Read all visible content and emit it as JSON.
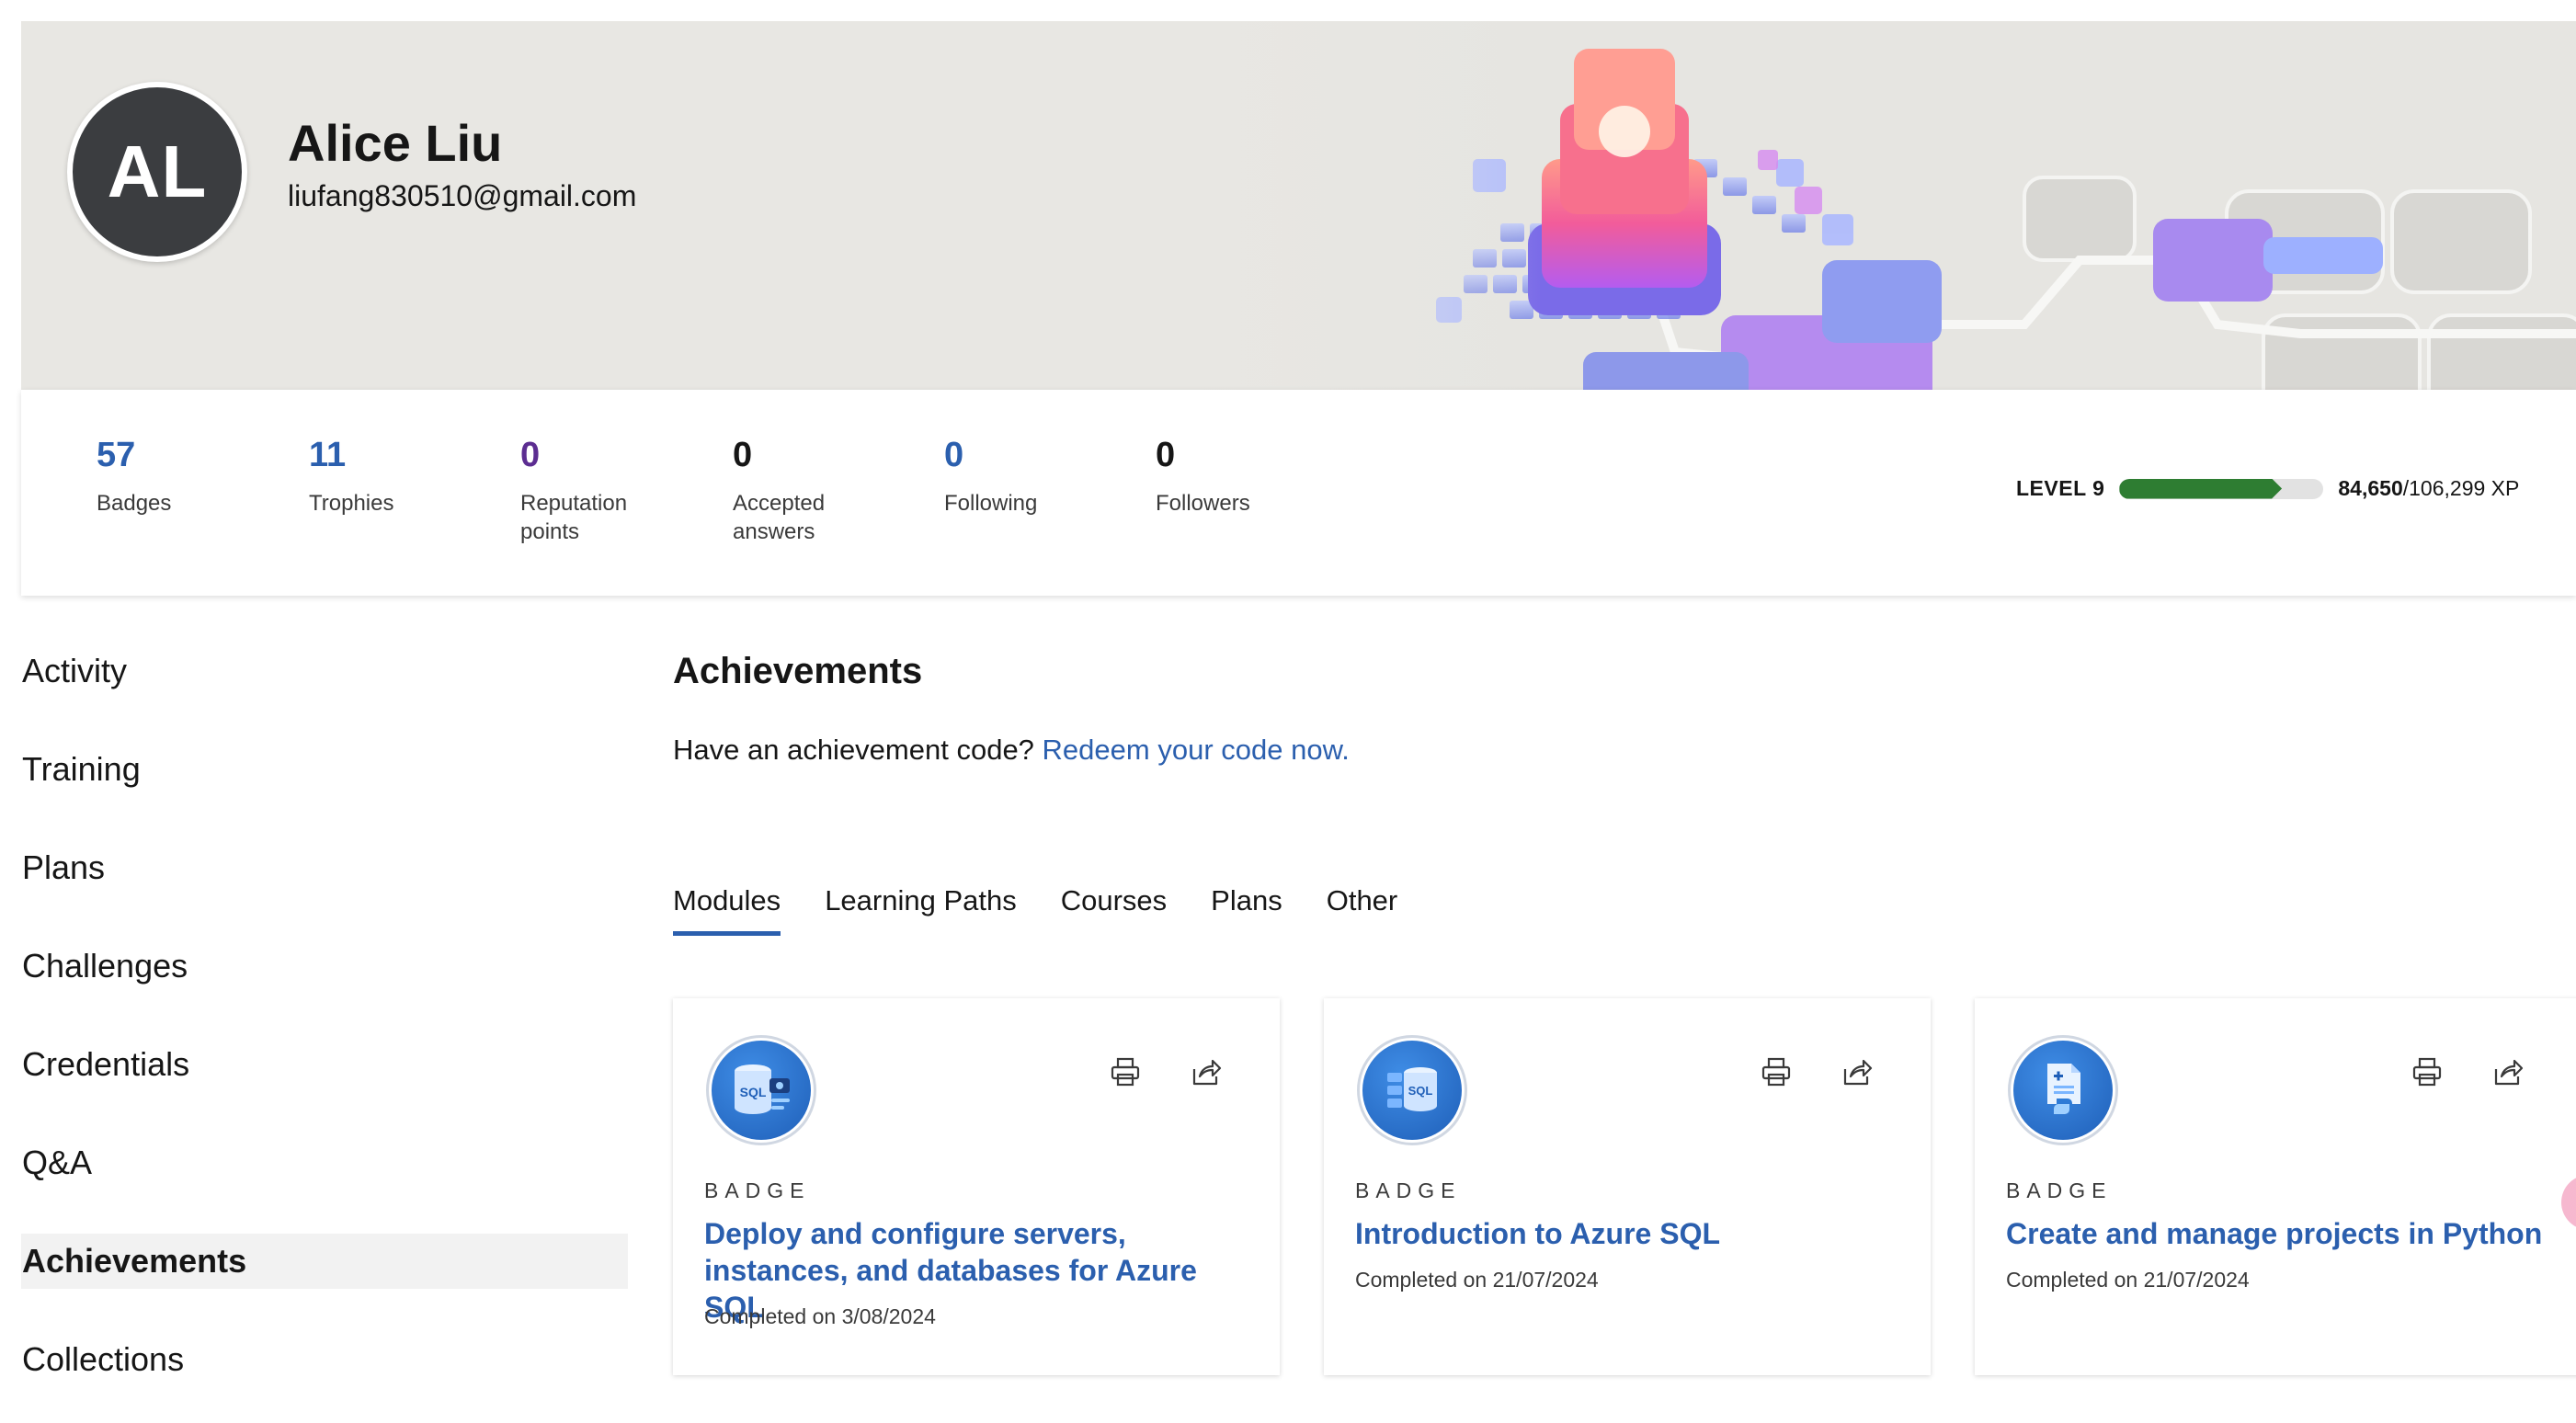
{
  "profile": {
    "initials": "AL",
    "name": "Alice Liu",
    "email": "liufang830510@gmail.com"
  },
  "stats": [
    {
      "value": "57",
      "label_line1": "Badges",
      "label_line2": "",
      "color": "#2b5fae"
    },
    {
      "value": "11",
      "label_line1": "Trophies",
      "label_line2": "",
      "color": "#2b5fae"
    },
    {
      "value": "0",
      "label_line1": "Reputation",
      "label_line2": "points",
      "color": "#5c2d91"
    },
    {
      "value": "0",
      "label_line1": "Accepted",
      "label_line2": "answers",
      "color": "#161616"
    },
    {
      "value": "0",
      "label_line1": "Following",
      "label_line2": "",
      "color": "#2b5fae"
    },
    {
      "value": "0",
      "label_line1": "Followers",
      "label_line2": "",
      "color": "#161616"
    }
  ],
  "level": {
    "label": "LEVEL 9",
    "xp_current": "84,650",
    "xp_total": "/106,299 XP",
    "progress_fraction": 0.796,
    "bar_color": "#2e7d32"
  },
  "sidebar": {
    "items": [
      {
        "label": "Activity",
        "active": false
      },
      {
        "label": "Training",
        "active": false
      },
      {
        "label": "Plans",
        "active": false
      },
      {
        "label": "Challenges",
        "active": false
      },
      {
        "label": "Credentials",
        "active": false
      },
      {
        "label": "Q&A",
        "active": false
      },
      {
        "label": "Achievements",
        "active": true
      },
      {
        "label": "Collections",
        "active": false
      }
    ]
  },
  "main": {
    "title": "Achievements",
    "redeem_prompt": "Have an achievement code?",
    "redeem_link": "Redeem your code now.",
    "tabs": [
      {
        "label": "Modules",
        "active": true
      },
      {
        "label": "Learning Paths",
        "active": false
      },
      {
        "label": "Courses",
        "active": false
      },
      {
        "label": "Plans",
        "active": false
      },
      {
        "label": "Other",
        "active": false
      }
    ],
    "cards": [
      {
        "kind": "BADGE",
        "title": "Deploy and configure servers, instances, and databases for Azure SQL",
        "completed": "Completed on 3/08/2024",
        "icon": "sql-database-icon"
      },
      {
        "kind": "BADGE",
        "title": "Introduction to Azure SQL",
        "completed": "Completed on 21/07/2024",
        "icon": "sql-database-icon"
      },
      {
        "kind": "BADGE",
        "title": "Create and manage projects in Python",
        "completed": "Completed on 21/07/2024",
        "icon": "python-document-icon"
      }
    ],
    "card_actions": [
      "print-icon",
      "share-icon"
    ]
  },
  "colors": {
    "accent": "#2b5fae",
    "hero_bg": "#e8e7e3",
    "active_nav_bg": "#f2f2f2"
  }
}
